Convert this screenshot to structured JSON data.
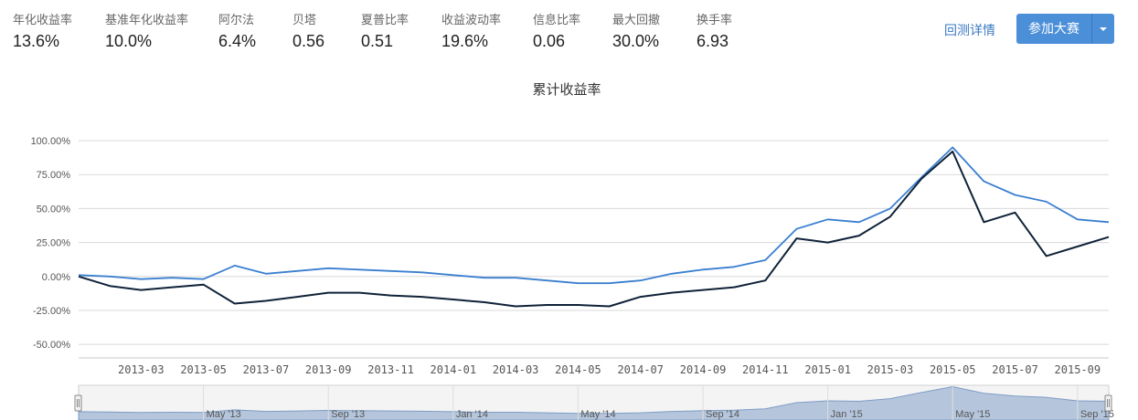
{
  "stats": [
    {
      "label": "年化收益率",
      "value": "13.6%"
    },
    {
      "label": "基准年化收益率",
      "value": "10.0%"
    },
    {
      "label": "阿尔法",
      "value": "6.4%"
    },
    {
      "label": "贝塔",
      "value": "0.56"
    },
    {
      "label": "夏普比率",
      "value": "0.51"
    },
    {
      "label": "收益波动率",
      "value": "19.6%"
    },
    {
      "label": "信息比率",
      "value": "0.06"
    },
    {
      "label": "最大回撤",
      "value": "30.0%"
    },
    {
      "label": "换手率",
      "value": "6.93"
    }
  ],
  "actions": {
    "detail_link": "回测详情",
    "join_button": "参加大赛"
  },
  "chart_data": {
    "type": "line",
    "title": "累计收益率",
    "ylabel": "",
    "ylim": [
      -60,
      100
    ],
    "y_ticks": [
      "100.00%",
      "75.00%",
      "50.00%",
      "25.00%",
      "0.00%",
      "-25.00%",
      "-50.00%"
    ],
    "x_ticks": [
      "2013-03",
      "2013-05",
      "2013-07",
      "2013-09",
      "2013-11",
      "2014-01",
      "2014-03",
      "2014-05",
      "2014-07",
      "2014-09",
      "2014-11",
      "2015-01",
      "2015-03",
      "2015-05",
      "2015-07",
      "2015-09"
    ],
    "grid": true,
    "x": [
      "2013-01",
      "2013-02",
      "2013-03",
      "2013-04",
      "2013-05",
      "2013-06",
      "2013-07",
      "2013-08",
      "2013-09",
      "2013-10",
      "2013-11",
      "2013-12",
      "2014-01",
      "2014-02",
      "2014-03",
      "2014-04",
      "2014-05",
      "2014-06",
      "2014-07",
      "2014-08",
      "2014-09",
      "2014-10",
      "2014-11",
      "2014-12",
      "2015-01",
      "2015-02",
      "2015-03",
      "2015-04",
      "2015-05",
      "2015-06",
      "2015-07",
      "2015-08",
      "2015-09",
      "2015-10"
    ],
    "series": [
      {
        "color": "#3a7fd0",
        "values": [
          1,
          0,
          -2,
          -1,
          -2,
          8,
          2,
          4,
          6,
          5,
          4,
          3,
          1,
          -1,
          -1,
          -3,
          -5,
          -5,
          -3,
          2,
          5,
          7,
          12,
          35,
          42,
          40,
          50,
          73,
          95,
          70,
          60,
          55,
          42,
          40
        ]
      },
      {
        "color": "#0f2238",
        "values": [
          0,
          -7,
          -10,
          -8,
          -6,
          -20,
          -18,
          -15,
          -12,
          -12,
          -14,
          -15,
          -17,
          -19,
          -22,
          -21,
          -21,
          -22,
          -15,
          -12,
          -10,
          -8,
          -3,
          28,
          25,
          30,
          44,
          72,
          92,
          40,
          47,
          15,
          22,
          29
        ]
      }
    ],
    "navigator": {
      "labels": [
        "May '13",
        "Sep '13",
        "Jan '14",
        "May '14",
        "Sep '14",
        "Jan '15",
        "May '15",
        "Sep '15"
      ]
    },
    "legend": "none"
  }
}
